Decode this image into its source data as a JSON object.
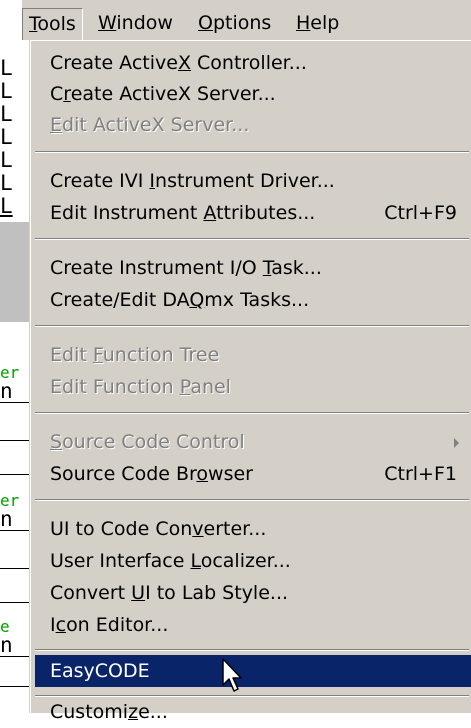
{
  "menubar": {
    "items": [
      {
        "label": "Tools",
        "mnemonic": "T",
        "active": true
      },
      {
        "label": "Window",
        "mnemonic": "W"
      },
      {
        "label": "Options",
        "mnemonic": "O"
      },
      {
        "label": "Help",
        "mnemonic": "H"
      }
    ]
  },
  "background_fragments": {
    "left_text": [
      "L",
      "L",
      "L",
      "L",
      "L",
      "L",
      "L",
      "er",
      "n",
      "er",
      "n",
      "e",
      "n"
    ]
  },
  "dropdown": {
    "items": [
      {
        "pre": "Create Active",
        "u": "X",
        "post": " Controller...",
        "shortcut": "",
        "disabled": false
      },
      {
        "pre": "C",
        "u": "r",
        "post": "eate ActiveX Server...",
        "shortcut": "",
        "disabled": false
      },
      {
        "pre": "",
        "u": "E",
        "post": "dit ActiveX Server...",
        "shortcut": "",
        "disabled": true
      },
      {
        "pre": "Create IVI ",
        "u": "I",
        "post": "nstrument Driver...",
        "shortcut": "",
        "disabled": false
      },
      {
        "pre": "Edit Instrument ",
        "u": "A",
        "post": "ttributes...",
        "shortcut": "Ctrl+F9",
        "disabled": false
      },
      {
        "pre": "Create Instrument I/O ",
        "u": "T",
        "post": "ask...",
        "shortcut": "",
        "disabled": false
      },
      {
        "pre": "Create/Edit DA",
        "u": "Q",
        "post": "mx Tasks...",
        "shortcut": "",
        "disabled": false
      },
      {
        "pre": "Edit ",
        "u": "F",
        "post": "unction Tree",
        "shortcut": "",
        "disabled": true
      },
      {
        "pre": "Edit Function ",
        "u": "P",
        "post": "anel",
        "shortcut": "",
        "disabled": true
      },
      {
        "pre": "",
        "u": "S",
        "post": "ource Code Control",
        "shortcut": "",
        "disabled": true,
        "submenu": true
      },
      {
        "pre": "Source Code Br",
        "u": "o",
        "post": "wser",
        "shortcut": "Ctrl+F1",
        "disabled": false
      },
      {
        "pre": "UI to Code Con",
        "u": "v",
        "post": "erter...",
        "shortcut": "",
        "disabled": false
      },
      {
        "pre": "User Interface ",
        "u": "L",
        "post": "ocalizer...",
        "shortcut": "",
        "disabled": false
      },
      {
        "pre": "Convert ",
        "u": "U",
        "post": "I to Lab Style...",
        "shortcut": "",
        "disabled": false
      },
      {
        "pre": "I",
        "u": "c",
        "post": "on Editor...",
        "shortcut": "",
        "disabled": false
      },
      {
        "pre": "EasyCODE",
        "u": "",
        "post": "",
        "shortcut": "",
        "disabled": false,
        "highlighted": true
      },
      {
        "pre": "Customi",
        "u": "z",
        "post": "e...",
        "shortcut": "",
        "disabled": false
      }
    ]
  },
  "colors": {
    "menu_bg": "#d4d0c8",
    "highlight": "#0a246a",
    "disabled_text": "#808080",
    "bg_green_text": "#00a000"
  },
  "cursor": {
    "icon": "mouse-pointer-arrow"
  }
}
